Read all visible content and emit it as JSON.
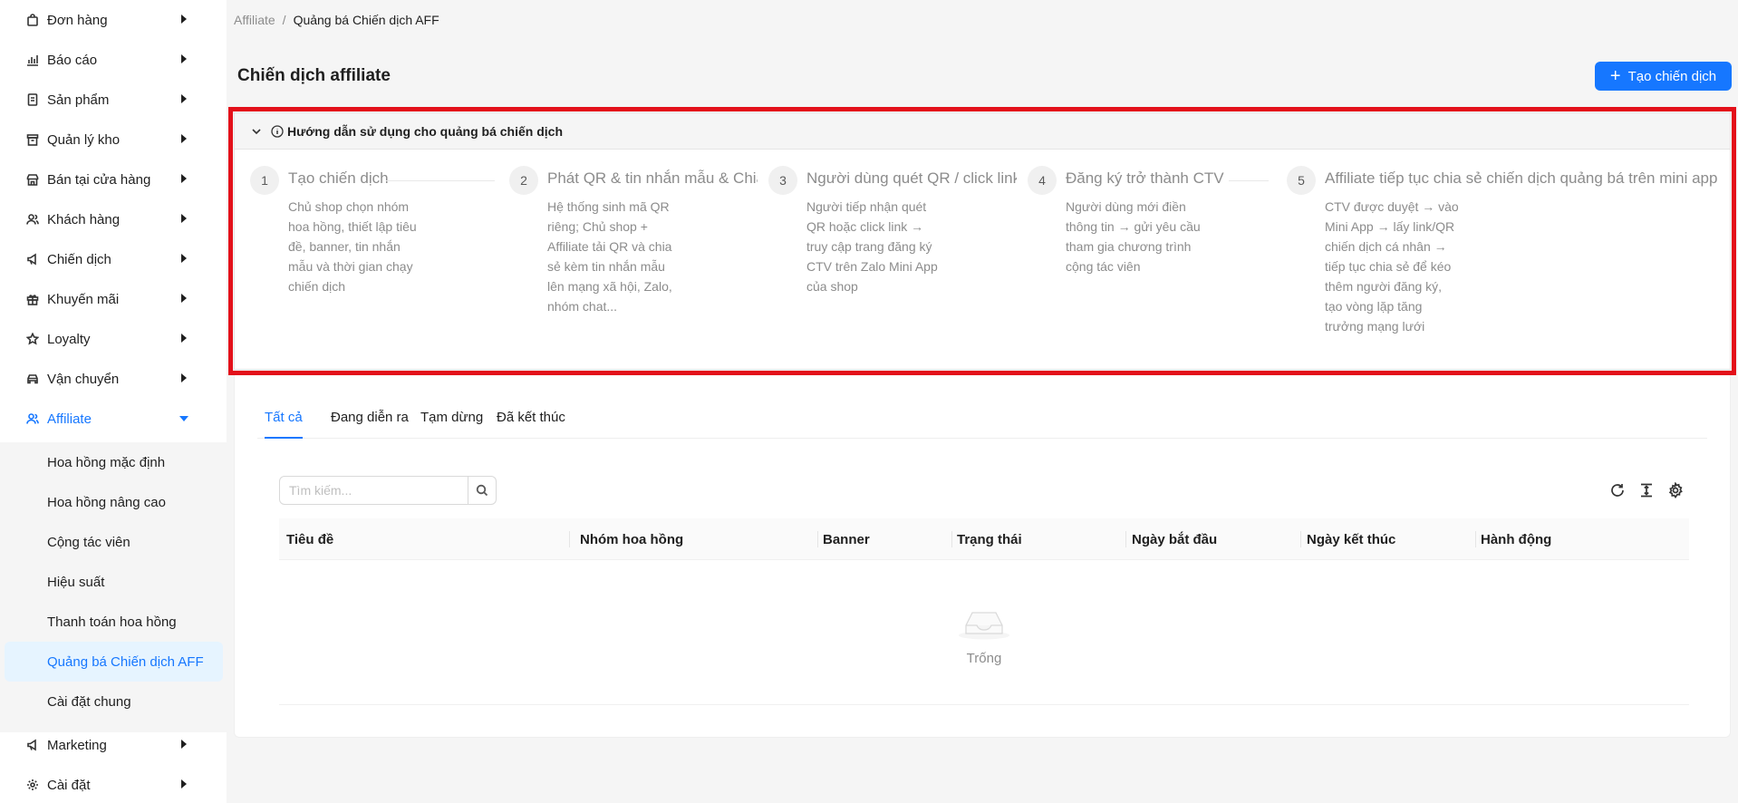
{
  "sidebar": {
    "items": [
      {
        "label": "Đơn hàng",
        "icon": "bag-icon"
      },
      {
        "label": "Báo cáo",
        "icon": "bar-chart-icon"
      },
      {
        "label": "Sản phẩm",
        "icon": "document-icon"
      },
      {
        "label": "Quản lý kho",
        "icon": "warehouse-icon"
      },
      {
        "label": "Bán tại cửa hàng",
        "icon": "store-icon"
      },
      {
        "label": "Khách hàng",
        "icon": "users-icon"
      },
      {
        "label": "Chiến dịch",
        "icon": "megaphone-icon"
      },
      {
        "label": "Khuyến mãi",
        "icon": "gift-icon"
      },
      {
        "label": "Loyalty",
        "icon": "star-icon"
      },
      {
        "label": "Vận chuyển",
        "icon": "car-icon"
      },
      {
        "label": "Affiliate",
        "icon": "users-icon"
      },
      {
        "label": "Marketing",
        "icon": "megaphone-icon"
      },
      {
        "label": "Cài đặt",
        "icon": "gear-icon"
      }
    ],
    "affiliate_sub": [
      "Hoa hồng mặc định",
      "Hoa hồng nâng cao",
      "Cộng tác viên",
      "Hiệu suất",
      "Thanh toán hoa hồng",
      "Quảng bá Chiến dịch AFF",
      "Cài đặt chung"
    ],
    "accent_color": "#1677ff"
  },
  "breadcrumb": {
    "root": "Affiliate",
    "separator": "/",
    "current": "Quảng bá Chiến dịch AFF"
  },
  "header": {
    "title": "Chiến dịch affiliate",
    "create_label": "Tạo chiến dịch"
  },
  "guide": {
    "title": "Hướng dẫn sử dụng cho quảng bá chiến dịch",
    "steps": [
      {
        "num": "1",
        "title": "Tạo chiến dịch",
        "desc": "Chủ shop chọn nhóm hoa hồng, thiết lập tiêu đề, banner, tin nhắn mẫu và thời gian chạy chiến dịch"
      },
      {
        "num": "2",
        "title": "Phát QR & tin nhắn mẫu & Chia sẻ",
        "desc": "Hệ thống sinh mã QR riêng; Chủ shop + Affiliate tải QR và chia sẻ kèm tin nhắn mẫu lên mạng xã hội, Zalo, nhóm chat..."
      },
      {
        "num": "3",
        "title": "Người dùng quét QR / click link",
        "desc": "Người tiếp nhận quét QR hoặc click link → truy cập trang đăng ký CTV trên Zalo Mini App của shop"
      },
      {
        "num": "4",
        "title": "Đăng ký trở thành CTV",
        "desc": "Người dùng mới điền thông tin → gửi yêu cầu tham gia chương trình cộng tác viên"
      },
      {
        "num": "5",
        "title": "Affiliate tiếp tục chia sẻ chiến dịch quảng bá trên mini app",
        "desc": "CTV được duyệt → vào Mini App → lấy link/QR chiến dịch cá nhân → tiếp tục chia sẻ để kéo thêm người đăng ký, tạo vòng lặp tăng trưởng mạng lưới"
      }
    ]
  },
  "tabs": [
    "Tất cả",
    "Đang diễn ra",
    "Tạm dừng",
    "Đã kết thúc"
  ],
  "search": {
    "placeholder": "Tìm kiếm..."
  },
  "table": {
    "columns": [
      "Tiêu đề",
      "Nhóm hoa hồng",
      "Banner",
      "Trạng thái",
      "Ngày bắt đầu",
      "Ngày kết thúc",
      "Hành động"
    ],
    "empty_text": "Trống"
  },
  "highlight_color": "#e3101a"
}
